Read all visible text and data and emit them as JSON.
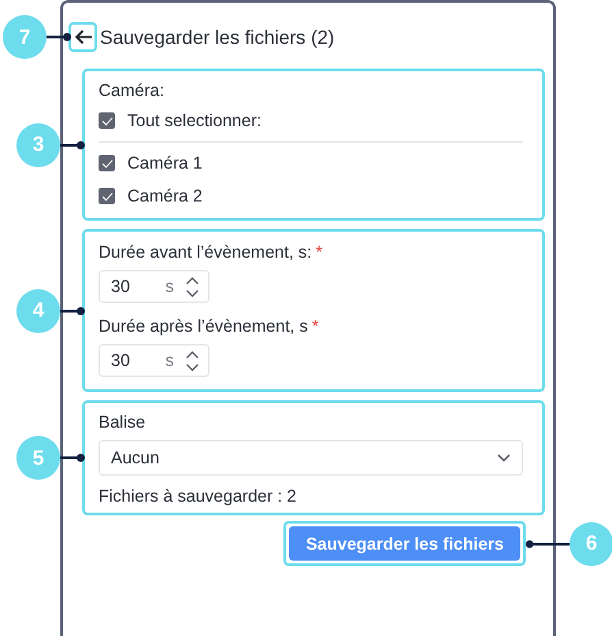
{
  "title": "Sauvegarder les fichiers (2)",
  "back_callout": "7",
  "camera_section": {
    "callout": "3",
    "label": "Caméra:",
    "select_all": {
      "label": "Tout selectionner:",
      "checked": true
    },
    "cameras": [
      {
        "label": "Caméra 1",
        "checked": true
      },
      {
        "label": "Caméra 2",
        "checked": true
      }
    ]
  },
  "duration_section": {
    "callout": "4",
    "fields": [
      {
        "label": "Durée avant l’évènement, s:",
        "required_mark": "*",
        "value": "30",
        "unit": "s"
      },
      {
        "label": "Durée après l’évènement, s",
        "required_mark": "*",
        "value": "30",
        "unit": "s"
      }
    ]
  },
  "tag_section": {
    "callout": "5",
    "label": "Balise",
    "value": "Aucun",
    "files_count": "Fichiers à sauvegarder : 2"
  },
  "save_button": "Sauvegarder les fichiers",
  "save_callout": "6"
}
